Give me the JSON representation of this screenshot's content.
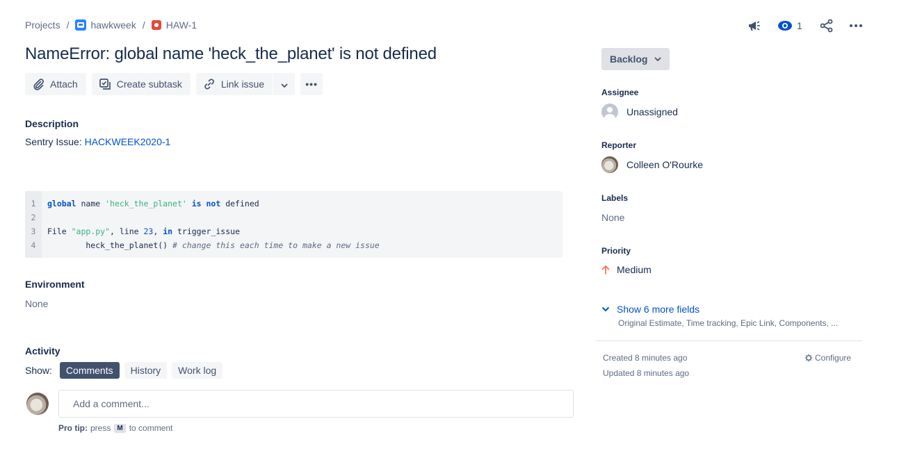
{
  "breadcrumb": {
    "projects": "Projects",
    "separator": "/",
    "project": "hawkweek",
    "issue_key": "HAW-1"
  },
  "top_actions": {
    "icons": [
      "feedback-megaphone-icon",
      "watch-eye-icon",
      "share-icon",
      "more-icon"
    ],
    "watch_count": "1"
  },
  "issue": {
    "title": "NameError: global name 'heck_the_planet' is not defined"
  },
  "toolbar": {
    "attach": "Attach",
    "create_subtask": "Create subtask",
    "link_issue": "Link issue",
    "more": "•••"
  },
  "description": {
    "label": "Description",
    "prefix": "Sentry Issue: ",
    "link": "HACKWEEK2020-1"
  },
  "code": {
    "line_numbers": [
      "1",
      "2",
      "3",
      "4"
    ],
    "l1_kw1": "global",
    "l1_t1": " name ",
    "l1_str": "'heck_the_planet'",
    "l1_sp": " ",
    "l1_kw2": "is not",
    "l1_t2": " defined",
    "l3_t1": "File ",
    "l3_str": "\"app.py\"",
    "l3_t2": ", line ",
    "l3_num": "23",
    "l3_t3": ", ",
    "l3_kw": "in",
    "l3_t4": " trigger_issue",
    "l4_t1": "        heck_the_planet() ",
    "l4_cmt": "# change this each time to make a new issue"
  },
  "environment": {
    "label": "Environment",
    "value": "None"
  },
  "activity": {
    "label": "Activity",
    "show_label": "Show:",
    "tabs": [
      "Comments",
      "History",
      "Work log"
    ],
    "active_tab": "Comments",
    "comment_placeholder": "Add a comment...",
    "protip_bold": "Pro tip:",
    "protip_press": "press",
    "protip_key": "M",
    "protip_rest": "to comment"
  },
  "sidebar": {
    "status": "Backlog",
    "assignee_label": "Assignee",
    "assignee_value": "Unassigned",
    "reporter_label": "Reporter",
    "reporter_value": "Colleen O'Rourke",
    "labels_label": "Labels",
    "labels_value": "None",
    "priority_label": "Priority",
    "priority_value": "Medium",
    "more_fields": "Show 6 more fields",
    "more_fields_sub": "Original Estimate, Time tracking, Epic Link, Components, ...",
    "created": "Created 8 minutes ago",
    "updated": "Updated 8 minutes ago",
    "configure": "Configure"
  },
  "colors": {
    "link": "#0052cc",
    "text": "#172b4d",
    "subtle": "#5e6c84",
    "priority_medium": "#ff7452",
    "bug": "#e5493a",
    "active_chip": "#42526e"
  }
}
